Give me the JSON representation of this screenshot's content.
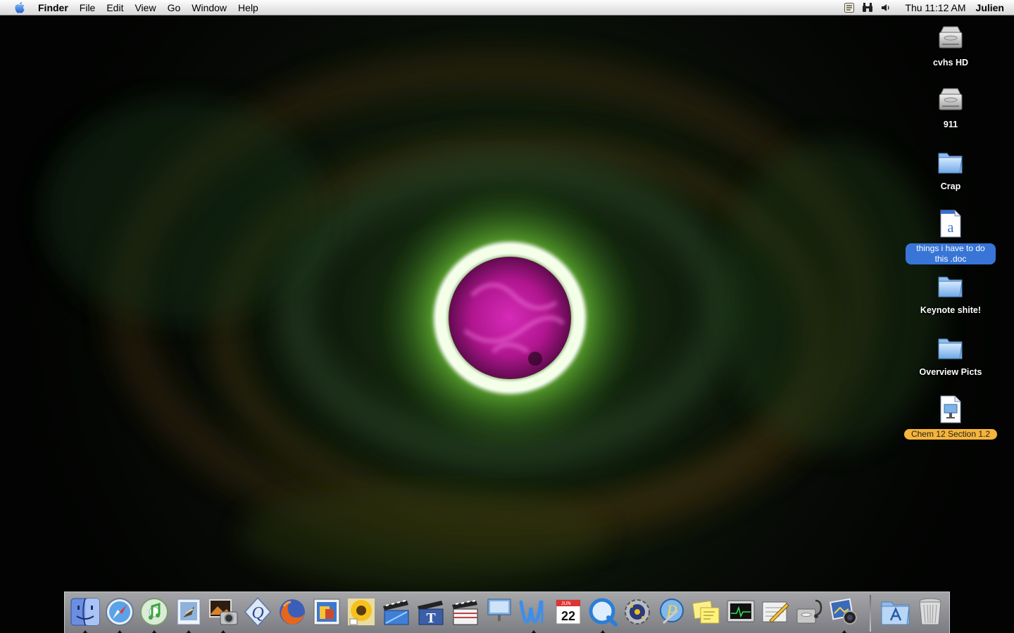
{
  "menubar": {
    "apple_icon": "apple-logo-icon",
    "app_name": "Finder",
    "menus": [
      "File",
      "Edit",
      "View",
      "Go",
      "Window",
      "Help"
    ],
    "status_icons": [
      "script-menu-icon",
      "binoculars-icon",
      "volume-icon"
    ],
    "clock": "Thu 11:12 AM",
    "user": "Julien"
  },
  "desktop": {
    "icons": [
      {
        "label": "cvhs HD",
        "icon": "hard-drive-icon",
        "selected": false
      },
      {
        "label": "911",
        "icon": "hard-drive-icon",
        "selected": false
      },
      {
        "label": "Crap",
        "icon": "folder-icon",
        "selected": false
      },
      {
        "label": "things i have to do this .doc",
        "icon": "word-document-icon",
        "selected": true,
        "label_color": "#3875d7"
      },
      {
        "label": "Keynote shite!",
        "icon": "folder-icon",
        "selected": false
      },
      {
        "label": "Overview Picts",
        "icon": "folder-icon",
        "selected": false
      },
      {
        "label": "Chem 12 Section 1.2",
        "icon": "keynote-document-icon",
        "selected": false,
        "label_color": "#f5b43a"
      }
    ]
  },
  "dock": {
    "apps": [
      {
        "name": "finder-icon",
        "running": true
      },
      {
        "name": "safari-icon",
        "running": true
      },
      {
        "name": "itunes-icon",
        "running": true
      },
      {
        "name": "mail-icon",
        "running": true
      },
      {
        "name": "iphoto-icon",
        "running": true
      },
      {
        "name": "quill-icon",
        "running": false
      },
      {
        "name": "firefox-icon",
        "running": false
      },
      {
        "name": "preview-icon",
        "running": false
      },
      {
        "name": "sunflower-icon",
        "running": false
      },
      {
        "name": "imovie-icon",
        "running": false
      },
      {
        "name": "text-edit-icon",
        "running": false
      },
      {
        "name": "clapperboard-icon",
        "running": false
      },
      {
        "name": "keynote-icon",
        "running": false
      },
      {
        "name": "word-icon",
        "running": true
      },
      {
        "name": "calendar-icon",
        "running": false,
        "text": "22",
        "month": "JUN"
      },
      {
        "name": "quicktime-icon",
        "running": true
      },
      {
        "name": "system-preferences-icon",
        "running": false
      },
      {
        "name": "script-editor-icon",
        "running": false
      },
      {
        "name": "stickies-icon",
        "running": false
      },
      {
        "name": "activity-monitor-icon",
        "running": false
      },
      {
        "name": "pencil-notepad-icon",
        "running": false
      },
      {
        "name": "disk-utility-icon",
        "running": false
      },
      {
        "name": "image-capture-icon",
        "running": true
      }
    ],
    "right_items": [
      {
        "name": "applications-folder-icon"
      },
      {
        "name": "trash-icon"
      }
    ]
  },
  "colors": {
    "menubar_top": "#fdfdfd",
    "menubar_bottom": "#d9d9d9",
    "wallpaper_ring": "#9cff4a",
    "wallpaper_core": "#c41aa5"
  }
}
